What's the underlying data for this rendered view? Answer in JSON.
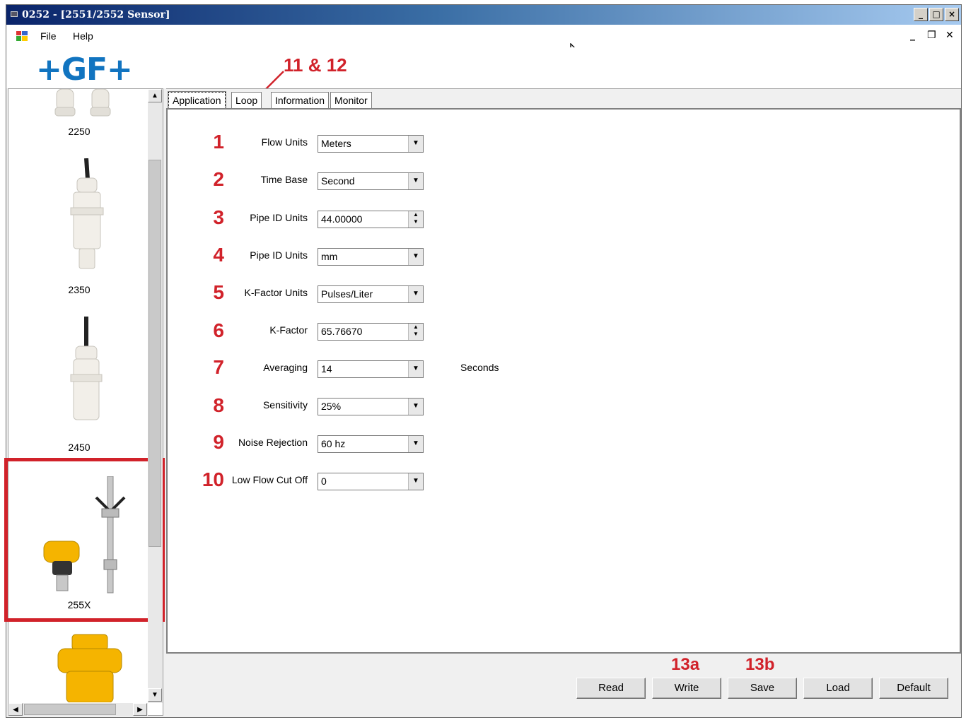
{
  "window": {
    "title": "0252 - [2551/2552 Sensor]"
  },
  "menu": {
    "file": "File",
    "help": "Help"
  },
  "logo": "+GF+",
  "annotations": {
    "tabs": "11 & 12",
    "write": "13a",
    "save": "13b"
  },
  "sensors": [
    {
      "label": "2250"
    },
    {
      "label": "2350"
    },
    {
      "label": "2450"
    },
    {
      "label": "255X"
    }
  ],
  "tabs": [
    "Application",
    "Loop",
    "Information",
    "Monitor"
  ],
  "fields": [
    {
      "num": "1",
      "label": "Flow Units",
      "value": "Meters",
      "control": "dropdown"
    },
    {
      "num": "2",
      "label": "Time Base",
      "value": "Second",
      "control": "dropdown"
    },
    {
      "num": "3",
      "label": "Pipe ID Units",
      "value": "44.00000",
      "control": "spinner"
    },
    {
      "num": "4",
      "label": "Pipe ID Units",
      "value": "mm",
      "control": "dropdown"
    },
    {
      "num": "5",
      "label": "K-Factor Units",
      "value": "Pulses/Liter",
      "control": "dropdown"
    },
    {
      "num": "6",
      "label": "K-Factor",
      "value": "65.76670",
      "control": "spinner"
    },
    {
      "num": "7",
      "label": "Averaging",
      "value": "14",
      "control": "dropdown",
      "suffix": "Seconds"
    },
    {
      "num": "8",
      "label": "Sensitivity",
      "value": "25%",
      "control": "dropdown"
    },
    {
      "num": "9",
      "label": "Noise Rejection",
      "value": "60 hz",
      "control": "dropdown"
    },
    {
      "num": "10",
      "label": "Low Flow Cut Off",
      "value": "0",
      "control": "dropdown"
    }
  ],
  "buttons": [
    "Read",
    "Write",
    "Save",
    "Load",
    "Default"
  ],
  "colors": {
    "annotation_red": "#d1222a",
    "logo_blue": "#1174c0",
    "sensor_yellow": "#f5b400"
  }
}
